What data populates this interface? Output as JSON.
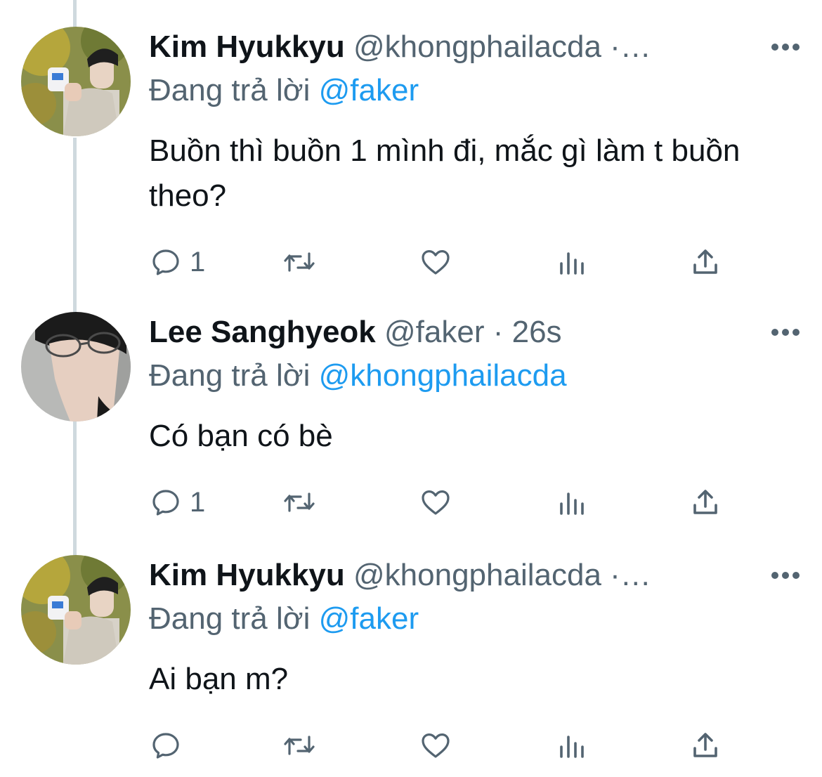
{
  "tweets": [
    {
      "name": "Kim Hyukkyu",
      "handle": "@khongphailacda ·…",
      "reply_prefix": "Đang trả lời ",
      "reply_mention": "@faker",
      "text": "Buồn thì buồn 1 mình đi, mắc gì làm t buồn theo?",
      "reply_count": "1"
    },
    {
      "name": "Lee Sanghyeok",
      "handle": "@faker · 26s",
      "reply_prefix": "Đang trả lời ",
      "reply_mention": "@khongphailacda",
      "text": "Có bạn có bè",
      "reply_count": "1"
    },
    {
      "name": "Kim Hyukkyu",
      "handle": "@khongphailacda ·…",
      "reply_prefix": "Đang trả lời ",
      "reply_mention": "@faker",
      "text": "Ai bạn m?",
      "reply_count": ""
    }
  ],
  "icons": {
    "reply": "reply-icon",
    "retweet": "retweet-icon",
    "like": "heart-icon",
    "analytics": "analytics-icon",
    "share": "share-icon",
    "more": "more-icon"
  },
  "colors": {
    "name": "#0f1419",
    "secondary": "#536471",
    "mention": "#1d9bf0",
    "thread_line": "#cfd9de"
  }
}
